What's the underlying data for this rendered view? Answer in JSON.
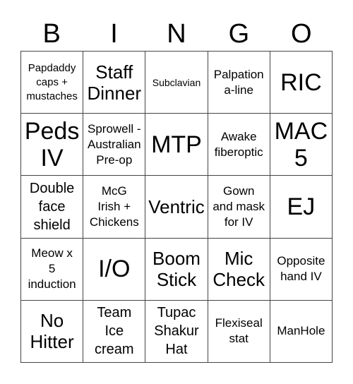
{
  "header": {
    "letters": [
      "B",
      "I",
      "N",
      "G",
      "O"
    ]
  },
  "board": {
    "rows": [
      [
        {
          "text": "Papdaddy\ncaps +\nmustaches",
          "size": "s-s"
        },
        {
          "text": "Staff\nDinner",
          "size": "s-l"
        },
        {
          "text": "Subclavian",
          "size": "s-xs"
        },
        {
          "text": "Palpation\na-line",
          "size": "s-sm"
        },
        {
          "text": "RIC",
          "size": "s-xl"
        }
      ],
      [
        {
          "text": "Peds\nIV",
          "size": "s-xl"
        },
        {
          "text": "Sprowell -\nAustralian\nPre-op",
          "size": "s-sm"
        },
        {
          "text": "MTP",
          "size": "s-xl"
        },
        {
          "text": "Awake\nfiberoptic",
          "size": "s-sm"
        },
        {
          "text": "MAC\n5",
          "size": "s-xl"
        }
      ],
      [
        {
          "text": "Double\nface\nshield",
          "size": "s-m"
        },
        {
          "text": "McG\nIrish +\nChickens",
          "size": "s-sm"
        },
        {
          "text": "Ventric",
          "size": "s-l"
        },
        {
          "text": "Gown\nand mask\nfor IV",
          "size": "s-sm"
        },
        {
          "text": "EJ",
          "size": "s-xl"
        }
      ],
      [
        {
          "text": "Meow x\n5\ninduction",
          "size": "s-sm"
        },
        {
          "text": "I/O",
          "size": "s-xl"
        },
        {
          "text": "Boom\nStick",
          "size": "s-l"
        },
        {
          "text": "Mic\nCheck",
          "size": "s-l"
        },
        {
          "text": "Opposite\nhand IV",
          "size": "s-sm"
        }
      ],
      [
        {
          "text": "No\nHitter",
          "size": "s-l"
        },
        {
          "text": "Team\nIce\ncream",
          "size": "s-m"
        },
        {
          "text": "Tupac\nShakur\nHat",
          "size": "s-m"
        },
        {
          "text": "Flexiseal\nstat",
          "size": "s-sm"
        },
        {
          "text": "ManHole",
          "size": "s-sm"
        }
      ]
    ]
  }
}
